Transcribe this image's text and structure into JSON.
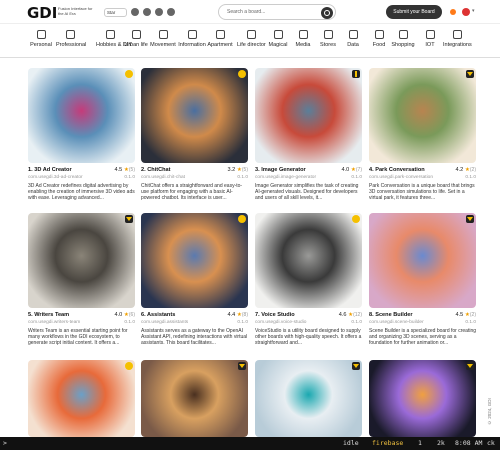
{
  "header": {
    "logo": "GDI",
    "logo_sub": "Fusion Interface for the AI Era",
    "star_label": "Star",
    "search_placeholder": "Search a board...",
    "submit_label": "Submit your Board"
  },
  "categories": [
    {
      "label": "Personal",
      "icon": "person-icon"
    },
    {
      "label": "Professional",
      "icon": "briefcase-icon"
    },
    {
      "label": "Hobbies & DIY",
      "icon": "tools-icon"
    },
    {
      "label": "Urban life",
      "icon": "city-icon"
    },
    {
      "label": "Movement",
      "icon": "walk-icon"
    },
    {
      "label": "Information",
      "icon": "info-icon"
    },
    {
      "label": "Apartment",
      "icon": "home-icon"
    },
    {
      "label": "Life director",
      "icon": "compass-icon"
    },
    {
      "label": "Magical",
      "icon": "wand-icon"
    },
    {
      "label": "Media",
      "icon": "play-icon"
    },
    {
      "label": "Stores",
      "icon": "store-icon"
    },
    {
      "label": "Data",
      "icon": "database-icon"
    },
    {
      "label": "Food",
      "icon": "food-icon"
    },
    {
      "label": "Shopping",
      "icon": "cart-icon"
    },
    {
      "label": "IOT",
      "icon": "wifi-icon"
    },
    {
      "label": "Integrations",
      "icon": "plug-icon"
    }
  ],
  "cards": [
    {
      "title": "1. 3D Ad Creator",
      "rating": "4.5",
      "count": "(5)",
      "slug": "com.usegdi.3d-ad-creator",
      "version": "0.1.0",
      "desc": "3D Ad Creator redefines digital advertising by enabling the creation of immersive 3D video ads with ease. Leveraging advanced...",
      "badge": "dot",
      "colors": [
        "#e8f0f4",
        "#5a8fb8",
        "#c53b7a"
      ]
    },
    {
      "title": "2. ChitChat",
      "rating": "3.2",
      "count": "(5)",
      "slug": "com.usegdi.chit-chat",
      "version": "0.1.0",
      "desc": "ChitChat offers a straightforward and easy-to-use platform for engaging with a basic AI-powered chatbot. Its interface is user...",
      "badge": "dot",
      "colors": [
        "#2b2f3a",
        "#d08a4a",
        "#4a6fa0"
      ]
    },
    {
      "title": "3. Image Generator",
      "rating": "4.0",
      "count": "(7)",
      "slug": "com.usegdi.image-generator",
      "version": "0.1.0",
      "desc": "Image Generator simplifies the task of creating AI-generated visuals. Designed for developers and users of all skill levels, it...",
      "badge": "bar",
      "colors": [
        "#e6ecef",
        "#c84a3a",
        "#5a7f9a"
      ]
    },
    {
      "title": "4. Park Conversation",
      "rating": "4.2",
      "count": "(2)",
      "slug": "com.usegdi.park-conversation",
      "version": "0.1.0",
      "desc": "Park Conversation is a unique board that brings 3D conversation simulations to life. Set in a virtual park, it features three...",
      "badge": "tri",
      "colors": [
        "#f2e8d8",
        "#7a9a5a",
        "#b88450"
      ]
    },
    {
      "title": "5. Writers Team",
      "rating": "4.0",
      "count": "(6)",
      "slug": "com.usegdi.writers-team",
      "version": "0.1.0",
      "desc": "Writers Team is an essential starting point for many workflows in the GDI ecosystem, to generate script initial content. It offers a...",
      "badge": "tri",
      "colors": [
        "#d8d4cc",
        "#4a4640",
        "#8a8478"
      ]
    },
    {
      "title": "6. Assistants",
      "rating": "4.4",
      "count": "(8)",
      "slug": "com.usegdi.assistants",
      "version": "0.1.0",
      "desc": "Assistants serves as a gateway to the OpenAI Assistant API, redefining interactions with virtual assistants. This board facilitates...",
      "badge": "dot",
      "colors": [
        "#2a3550",
        "#d89050",
        "#5a7ab0"
      ]
    },
    {
      "title": "7. Voice Studio",
      "rating": "4.6",
      "count": "(12)",
      "slug": "com.usegdi.voice-studio",
      "version": "0.1.0",
      "desc": "VoiceStudio is a utility board designed to supply other boards with high-quality speech. It offers a straightforward and...",
      "badge": "dot",
      "colors": [
        "#f0f0ee",
        "#3a3a3a",
        "#9a9a98"
      ]
    },
    {
      "title": "8. Scene Builder",
      "rating": "4.5",
      "count": "(2)",
      "slug": "com.usegdi.scene-builder",
      "version": "0.1.0",
      "desc": "Scene Builder is a specialized board for creating and organizing 3D scenes, serving as a foundation for further animation or...",
      "badge": "tri",
      "colors": [
        "#d8a8c8",
        "#e88a6a",
        "#6a8ad0"
      ]
    },
    {
      "title": "",
      "rating": "",
      "count": "",
      "slug": "",
      "version": "",
      "desc": "",
      "badge": "dot",
      "colors": [
        "#f4e0d0",
        "#e86a3a",
        "#6aa0c8"
      ]
    },
    {
      "title": "",
      "rating": "",
      "count": "",
      "slug": "",
      "version": "",
      "desc": "",
      "badge": "tri",
      "colors": [
        "#7a5a48",
        "#d8a060",
        "#4a3020"
      ]
    },
    {
      "title": "",
      "rating": "",
      "count": "",
      "slug": "",
      "version": "",
      "desc": "",
      "badge": "tri",
      "colors": [
        "#b8ccd8",
        "#e8eef2",
        "#1aa8b0"
      ]
    },
    {
      "title": "",
      "rating": "",
      "count": "",
      "slug": "",
      "version": "",
      "desc": "",
      "badge": "tri",
      "colors": [
        "#1a1a2a",
        "#9a6ad8",
        "#f0a040"
      ]
    }
  ],
  "side_copyright": "© 2024, GDI",
  "terminal": {
    "prompt": ">",
    "status": "idle",
    "branch": "firebase",
    "count1": "1",
    "count2": "2k",
    "time": "8:08 AM",
    "end": "ck"
  }
}
